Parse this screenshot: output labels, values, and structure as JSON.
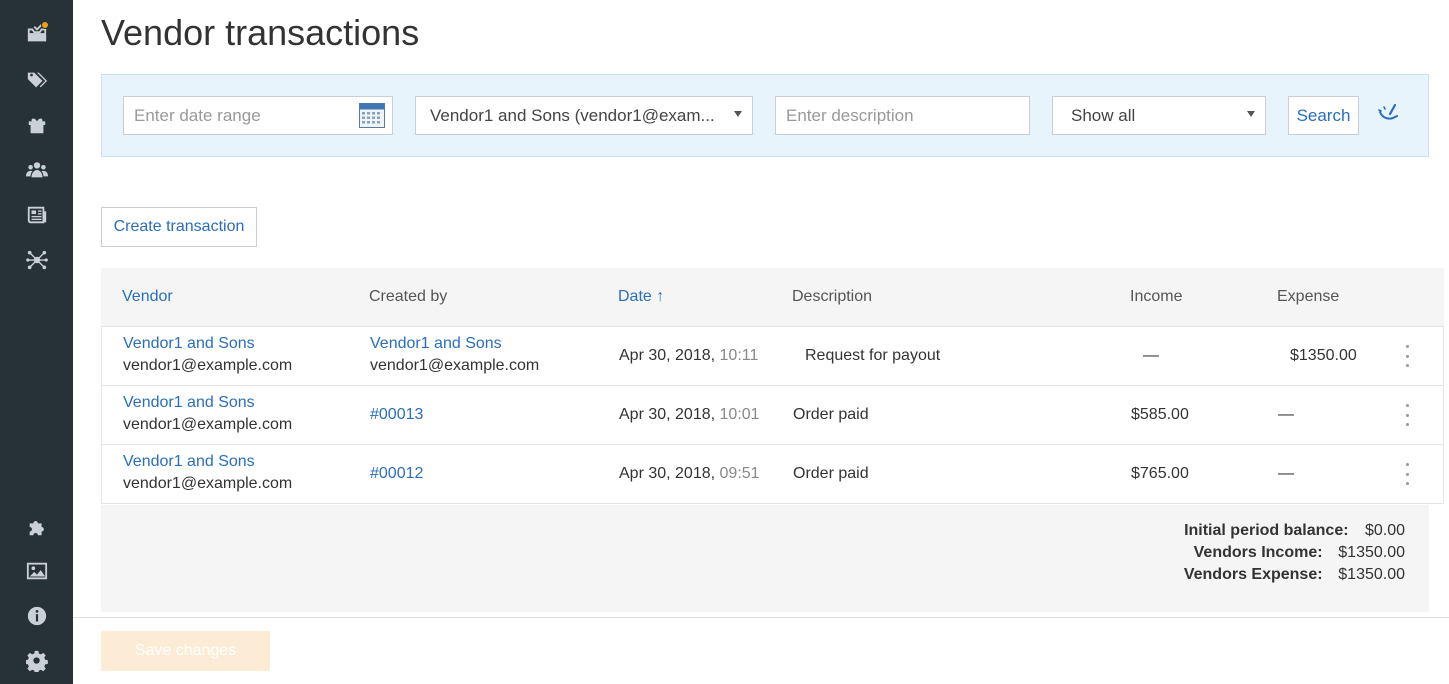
{
  "sidebar": {
    "items": [
      {
        "icon": "orders-icon"
      },
      {
        "icon": "tags-icon"
      },
      {
        "icon": "gift-icon"
      },
      {
        "icon": "users-icon"
      },
      {
        "icon": "news-icon"
      },
      {
        "icon": "network-icon"
      },
      {
        "icon": "puzzle-icon"
      },
      {
        "icon": "image-icon"
      },
      {
        "icon": "info-icon"
      },
      {
        "icon": "gear-icon"
      }
    ]
  },
  "page": {
    "title": "Vendor transactions"
  },
  "filters": {
    "date_placeholder": "Enter date range",
    "vendor_value": "Vendor1 and Sons (vendor1@exam...",
    "description_placeholder": "Enter description",
    "type_value": "Show all",
    "search_label": "Search"
  },
  "actions": {
    "create_label": "Create transaction",
    "save_label": "Save changes"
  },
  "table": {
    "headers": {
      "vendor": "Vendor",
      "created_by": "Created by",
      "date": "Date ↑",
      "description": "Description",
      "income": "Income",
      "expense": "Expense"
    },
    "rows": [
      {
        "vendor_name": "Vendor1 and Sons",
        "vendor_email": "vendor1@example.com",
        "created_by_name": "Vendor1 and Sons",
        "created_by_email": "vendor1@example.com",
        "date": "Apr 30, 2018,",
        "time": "10:11",
        "description": "Request for payout",
        "income": "—",
        "expense": "$1350.00"
      },
      {
        "vendor_name": "Vendor1 and Sons",
        "vendor_email": "vendor1@example.com",
        "created_by_name": "#00013",
        "created_by_email": "",
        "date": "Apr 30, 2018,",
        "time": "10:01",
        "description": "Order paid",
        "income": "$585.00",
        "expense": "—"
      },
      {
        "vendor_name": "Vendor1 and Sons",
        "vendor_email": "vendor1@example.com",
        "created_by_name": "#00012",
        "created_by_email": "",
        "date": "Apr 30, 2018,",
        "time": "09:51",
        "description": "Order paid",
        "income": "$765.00",
        "expense": "—"
      }
    ]
  },
  "totals": {
    "initial_label": "Initial period balance:",
    "initial_value": "$0.00",
    "income_label": "Vendors Income:",
    "income_value": "$1350.00",
    "expense_label": "Vendors Expense:",
    "expense_value": "$1350.00"
  },
  "colors": {
    "sidebar": "#263238",
    "link": "#2a6ebb",
    "filter_bg": "#e8f4fc",
    "notification": "#f39c12",
    "save_disabled": "#fcecd5"
  }
}
